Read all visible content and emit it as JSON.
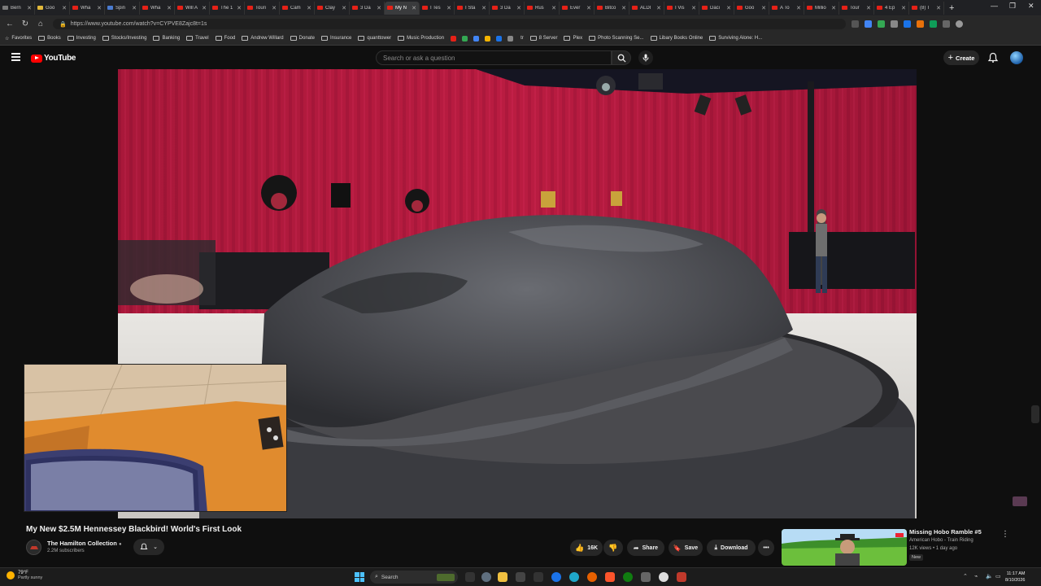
{
  "browser": {
    "tabs": [
      {
        "label": "Bern"
      },
      {
        "label": "Goo"
      },
      {
        "label": "Wha"
      },
      {
        "label": "Spin"
      },
      {
        "label": "Wha"
      },
      {
        "label": "Will A"
      },
      {
        "label": "The 1"
      },
      {
        "label": "Touri"
      },
      {
        "label": "Cam"
      },
      {
        "label": "Clay"
      },
      {
        "label": "3 Da"
      },
      {
        "label": "My N"
      },
      {
        "label": "I Tes"
      },
      {
        "label": "I Sta"
      },
      {
        "label": "3 Da"
      },
      {
        "label": "Rus"
      },
      {
        "label": "Ever"
      },
      {
        "label": "Bitco"
      },
      {
        "label": "ALDI"
      },
      {
        "label": "I Vis"
      },
      {
        "label": "Daci"
      },
      {
        "label": "Goo"
      },
      {
        "label": "A To"
      },
      {
        "label": "Millio"
      },
      {
        "label": "Tour"
      },
      {
        "label": "4 Ep"
      },
      {
        "label": "(8) T"
      }
    ],
    "active_tab": 11,
    "url": "https://www.youtube.com/watch?v=CYPVE8Zajc8t=1s",
    "bookmarks": [
      {
        "label": "Favorites"
      },
      {
        "label": "Books"
      },
      {
        "label": "Investing"
      },
      {
        "label": "Stocks/Investing"
      },
      {
        "label": "Banking"
      },
      {
        "label": "Travel"
      },
      {
        "label": "Food"
      },
      {
        "label": "Andrew Willard"
      },
      {
        "label": "Donate"
      },
      {
        "label": "Insurance"
      },
      {
        "label": "quanttower"
      },
      {
        "label": "Music Production"
      },
      {
        "label": "tr"
      },
      {
        "label": "8 Server"
      },
      {
        "label": "Plex"
      },
      {
        "label": "Photo Scanning Se..."
      },
      {
        "label": "Libary Books Online"
      },
      {
        "label": "Surviving Alone: H..."
      }
    ]
  },
  "youtube": {
    "logo_text": "YouTube",
    "search_placeholder": "Search or ask a question",
    "create_label": "Create"
  },
  "video": {
    "title": "My New $2.5M Hennessey Blackbird! World's First Look",
    "channel": "The Hamilton Collection",
    "subscribers": "2.2M subscribers",
    "likes": "16K",
    "share_label": "Share",
    "save_label": "Save",
    "download_label": "Download"
  },
  "recommendation": {
    "title": "Missing Hobo Ramble #5",
    "channel": "American Hobo - Train Riding",
    "meta": "12K views • 1 day ago",
    "badge": "New"
  },
  "taskbar": {
    "weather_temp": "79°F",
    "weather_cond": "Partly sunny",
    "search_label": "Search",
    "time": "11:17 AM",
    "date": "8/10/2026"
  }
}
